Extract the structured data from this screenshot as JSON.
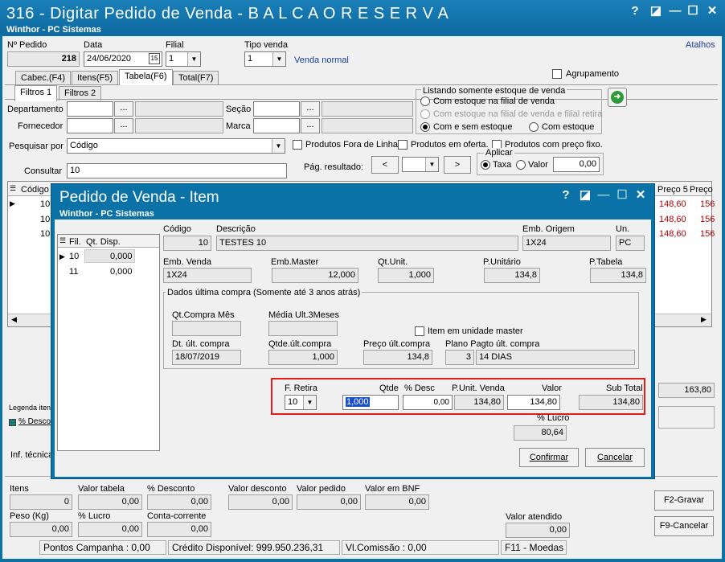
{
  "window": {
    "title": "316 - Digitar Pedido de Venda - B A L C A O  R E S E R V A",
    "subtitle": "Winthor - PC Sistemas",
    "help": "?",
    "restore": "◪",
    "minimize": "—",
    "maximize": "☐",
    "close": "✕"
  },
  "header": {
    "pedido_label": "Nº Pedido",
    "pedido_value": "218",
    "data_label": "Data",
    "data_value": "24/06/2020",
    "calendar": "15",
    "filial_label": "Filial",
    "filial_value": "1",
    "tipo_label": "Tipo venda",
    "tipo_value": "1",
    "tipo_desc": "Venda normal",
    "atalhos": "Atalhos",
    "agrupamento": "Agrupamento"
  },
  "tabs": [
    "Cabec.(F4)",
    "Itens(F5)",
    "Tabela(F6)",
    "Total(F7)"
  ],
  "subtabs": [
    "Filtros 1",
    "Filtros 2"
  ],
  "filters": {
    "departamento": "Departamento",
    "fornecedor": "Fornecedor",
    "secao": "Seção",
    "marca": "Marca",
    "dots": "...",
    "estoque_title": "Listando somente estoque de venda",
    "opt1": "Com estoque na filial de venda",
    "opt2": "Com estoque na filial de venda e filial retira",
    "opt3": "Com e sem estoque",
    "opt4": "Com estoque",
    "pesquisar_label": "Pesquisar por",
    "pesquisar_value": "Código",
    "fora_linha": "Produtos Fora de Linha",
    "oferta": "Produtos em oferta.",
    "preco_fixo": "Produtos com preço fixo.",
    "consultar_label": "Consultar",
    "consultar_value": "10",
    "pag_label": "Pág. resultado:",
    "prev": "<",
    "next": ">",
    "aplicar_title": "Aplicar",
    "taxa": "Taxa",
    "valor": "Valor",
    "aplicar_value": "0,00"
  },
  "grid": {
    "col_codigo": "Código",
    "col_preco5": "Preço 5",
    "col_preco": "Preço",
    "rows": [
      {
        "codigo": "10",
        "preco5": "148,60",
        "preco": "156"
      },
      {
        "codigo": "10",
        "preco5": "148,60",
        "preco": "156"
      },
      {
        "codigo": "10",
        "preco5": "148,60",
        "preco": "156"
      }
    ]
  },
  "legend": {
    "title": "Legenda iten",
    "item": "% Descon",
    "right_value": "163,80",
    "inf_tecnica": "Inf. técnica"
  },
  "totals": {
    "itens_label": "Itens",
    "itens_value": "0",
    "valor_tabela_label": "Valor tabela",
    "valor_tabela_value": "0,00",
    "desconto_label": "% Desconto",
    "desconto_value": "0,00",
    "valor_desconto_label": "Valor desconto",
    "valor_desconto_value": "0,00",
    "valor_pedido_label": "Valor pedido",
    "valor_pedido_value": "0,00",
    "valor_bnf_label": "Valor em BNF",
    "valor_bnf_value": "0,00",
    "peso_label": "Peso (Kg)",
    "peso_value": "0,00",
    "lucro_label": "% Lucro",
    "lucro_value": "0,00",
    "conta_label": "Conta-corrente",
    "conta_value": "0,00",
    "valor_atendido_label": "Valor atendido",
    "valor_atendido_value": "0,00",
    "gravar": "F2-Gravar",
    "cancelar": "F9-Cancelar"
  },
  "statusbar": {
    "pontos": "Pontos Campanha : 0,00",
    "credito": "Crédito Disponível: 999.950.236,31",
    "comissao": "Vl.Comissão : 0,00",
    "moedas": "F11 - Moedas"
  },
  "modal": {
    "title": "Pedido de Venda - Item",
    "subtitle": "Winthor - PC Sistemas",
    "help": "?",
    "restore": "◪",
    "minimize": "—",
    "maximize": "☐",
    "close": "✕",
    "fil_header": "Fil.",
    "disp_header": "Qt. Disp.",
    "fil_rows": [
      {
        "fil": "10",
        "disp": "0,000"
      },
      {
        "fil": "11",
        "disp": "0,000"
      }
    ],
    "codigo_label": "Código",
    "codigo_value": "10",
    "descricao_label": "Descrição",
    "descricao_value": "TESTES 10",
    "emb_origem_label": "Emb. Origem",
    "emb_origem_value": "1X24",
    "un_label": "Un.",
    "un_value": "PC",
    "emb_venda_label": "Emb. Venda",
    "emb_venda_value": "1X24",
    "emb_master_label": "Emb.Master",
    "emb_master_value": "12,000",
    "qt_unit_label": "Qt.Unit.",
    "qt_unit_value": "1,000",
    "p_unitario_label": "P.Unitário",
    "p_unitario_value": "134,8",
    "p_tabela_label": "P.Tabela",
    "p_tabela_value": "134,8",
    "dados_title": "Dados última compra (Somente até 3 anos atrás)",
    "qt_compra_mes_label": "Qt.Compra Mês",
    "qt_compra_mes_value": "",
    "media_label": "Média Ult.3Meses",
    "media_value": "",
    "item_master": "Item em unidade master",
    "dt_ult_label": "Dt. últ. compra",
    "dt_ult_value": "18/07/2019",
    "qtde_ult_label": "Qtde.últ.compra",
    "qtde_ult_value": "1,000",
    "preco_ult_label": "Preço últ.compra",
    "preco_ult_value": "134,8",
    "plano_label": "Plano Pagto últ. compra",
    "plano_code": "3",
    "plano_desc": "14 DIAS",
    "f_retira_label": "F. Retira",
    "f_retira_value": "10",
    "qtde_label": "Qtde",
    "qtde_value": "1,000",
    "pdesc_label": "% Desc",
    "pdesc_value": "0,00",
    "punit_label": "P.Unit. Venda",
    "punit_value": "134,80",
    "valor_label": "Valor",
    "valor_value": "134,80",
    "subtotal_label": "Sub Total",
    "subtotal_value": "134,80",
    "lucro_label": "% Lucro",
    "lucro_value": "80,64",
    "confirmar": "Confirmar",
    "cancelar": "Cancelar"
  }
}
